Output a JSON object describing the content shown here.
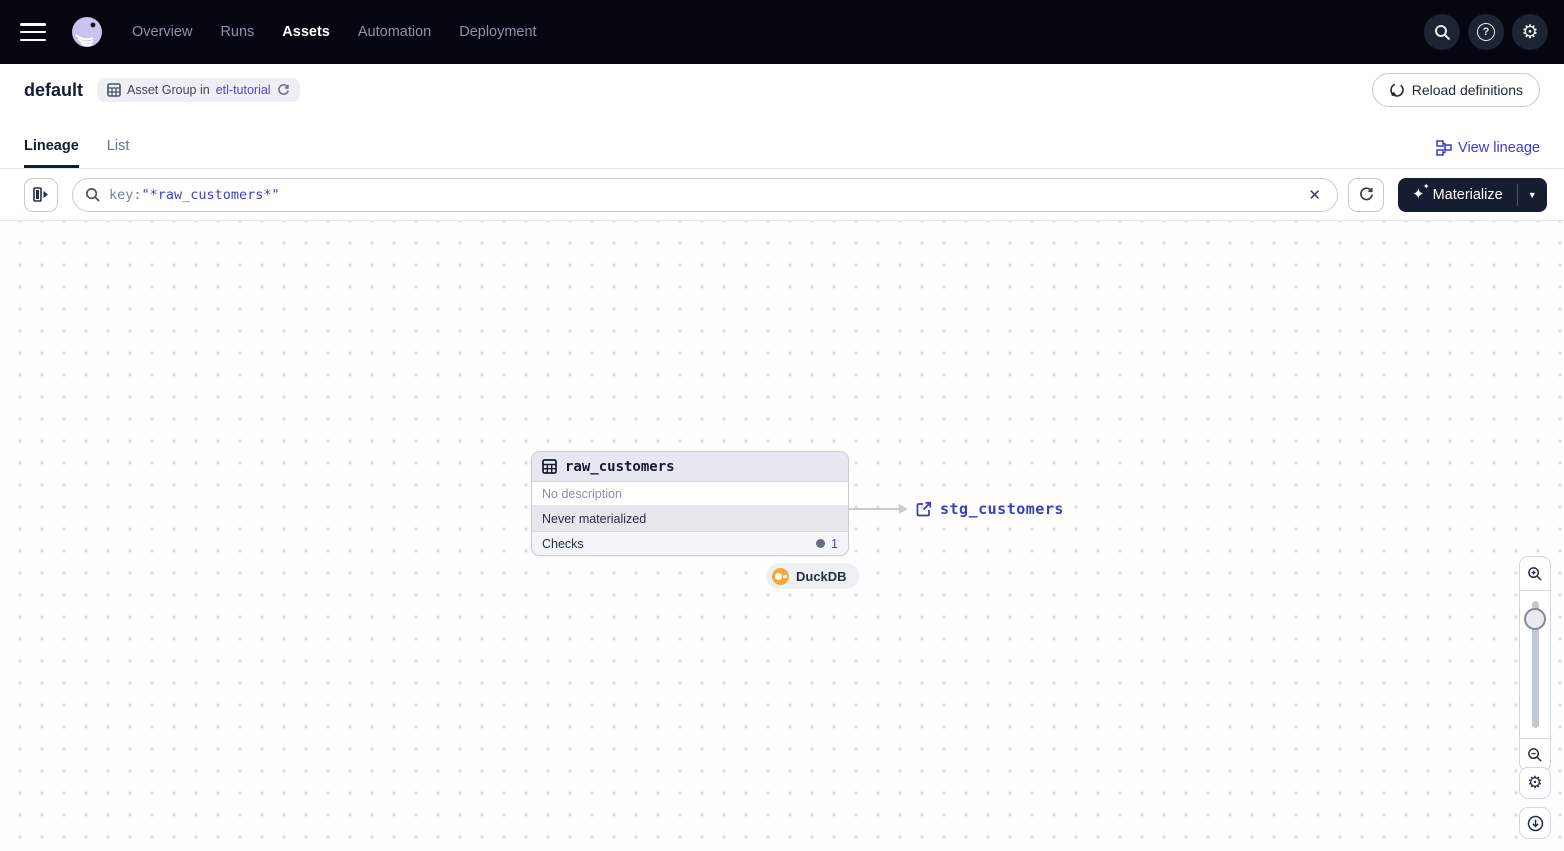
{
  "nav": {
    "items": [
      {
        "label": "Overview",
        "active": false
      },
      {
        "label": "Runs",
        "active": false
      },
      {
        "label": "Assets",
        "active": true
      },
      {
        "label": "Automation",
        "active": false
      },
      {
        "label": "Deployment",
        "active": false
      }
    ],
    "icons": [
      "search-icon",
      "help-icon",
      "settings-icon"
    ],
    "colors": {
      "bar_bg": "#04070F",
      "active_text": "#FFFFFF",
      "inactive_text": "#8B93A7"
    }
  },
  "header": {
    "title": "default",
    "badge": {
      "prefix": "Asset Group in",
      "link": "etl-tutorial"
    },
    "reload_button": "Reload definitions"
  },
  "tabs": {
    "items": [
      {
        "label": "Lineage",
        "active": true
      },
      {
        "label": "List",
        "active": false
      }
    ],
    "view_lineage": "View lineage"
  },
  "toolbar": {
    "search_prefix": "key:",
    "search_value": "\"*raw_customers*\"",
    "clear_label": "✕",
    "materialize_label": "Materialize",
    "caret": "▼"
  },
  "graph": {
    "node": {
      "title": "raw_customers",
      "description": "No description",
      "status": "Never materialized",
      "checks_label": "Checks",
      "checks_count": "1"
    },
    "kind_badge": "DuckDB",
    "downstream": "stg_customers"
  },
  "colors": {
    "accent_indigo": "#4744D0",
    "link_blue": "#3D3BC7",
    "mono_value": "#3F3FC8",
    "duckdb_orange": "#F3A93C",
    "materialize_bg": "#161D30"
  }
}
